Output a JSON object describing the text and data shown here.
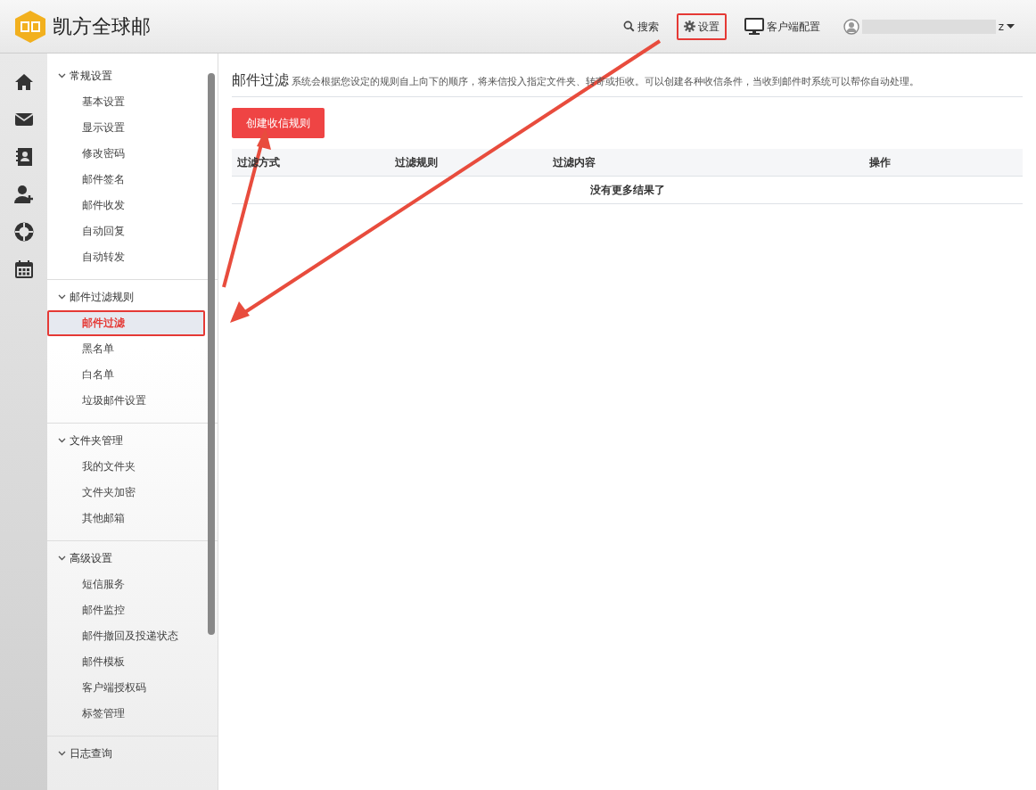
{
  "header": {
    "brand": "凯方全球邮",
    "nav": [
      {
        "kind": "search",
        "label": "搜索",
        "highlighted": false
      },
      {
        "kind": "gear",
        "label": "设置",
        "highlighted": true
      },
      {
        "kind": "monitor",
        "label": "客户端配置",
        "highlighted": false
      }
    ],
    "user": {
      "name_visible": "z"
    }
  },
  "rail": [
    {
      "kind": "home"
    },
    {
      "kind": "mail"
    },
    {
      "kind": "contacts"
    },
    {
      "kind": "add-user"
    },
    {
      "kind": "lifebuoy"
    },
    {
      "kind": "calendar"
    }
  ],
  "menu": [
    {
      "title": "常规设置",
      "expanded": true,
      "items": [
        {
          "label": "基本设置",
          "selected": false,
          "highlighted": false
        },
        {
          "label": "显示设置",
          "selected": false,
          "highlighted": false
        },
        {
          "label": "修改密码",
          "selected": false,
          "highlighted": false
        },
        {
          "label": "邮件签名",
          "selected": false,
          "highlighted": false
        },
        {
          "label": "邮件收发",
          "selected": false,
          "highlighted": false
        },
        {
          "label": "自动回复",
          "selected": false,
          "highlighted": false
        },
        {
          "label": "自动转发",
          "selected": false,
          "highlighted": false
        }
      ]
    },
    {
      "title": "邮件过滤规则",
      "expanded": true,
      "items": [
        {
          "label": "邮件过滤",
          "selected": true,
          "highlighted": true
        },
        {
          "label": "黑名单",
          "selected": false,
          "highlighted": false
        },
        {
          "label": "白名单",
          "selected": false,
          "highlighted": false
        },
        {
          "label": "垃圾邮件设置",
          "selected": false,
          "highlighted": false
        }
      ]
    },
    {
      "title": "文件夹管理",
      "expanded": true,
      "items": [
        {
          "label": "我的文件夹",
          "selected": false,
          "highlighted": false
        },
        {
          "label": "文件夹加密",
          "selected": false,
          "highlighted": false
        },
        {
          "label": "其他邮箱",
          "selected": false,
          "highlighted": false
        }
      ]
    },
    {
      "title": "高级设置",
      "expanded": true,
      "items": [
        {
          "label": "短信服务",
          "selected": false,
          "highlighted": false
        },
        {
          "label": "邮件监控",
          "selected": false,
          "highlighted": false
        },
        {
          "label": "邮件撤回及投递状态",
          "selected": false,
          "highlighted": false
        },
        {
          "label": "邮件模板",
          "selected": false,
          "highlighted": false
        },
        {
          "label": "客户端授权码",
          "selected": false,
          "highlighted": false
        },
        {
          "label": "标签管理",
          "selected": false,
          "highlighted": false
        }
      ]
    },
    {
      "title": "日志查询",
      "expanded": true
    }
  ],
  "content": {
    "title": "邮件过滤",
    "description": "系统会根据您设定的规则自上向下的顺序，将来信投入指定文件夹、转寄或拒收。可以创建各种收信条件，当收到邮件时系统可以帮你自动处理。",
    "create_button": "创建收信规则",
    "table": {
      "columns": [
        "过滤方式",
        "过滤规则",
        "过滤内容",
        "操作"
      ],
      "empty_message": "没有更多结果了"
    }
  }
}
